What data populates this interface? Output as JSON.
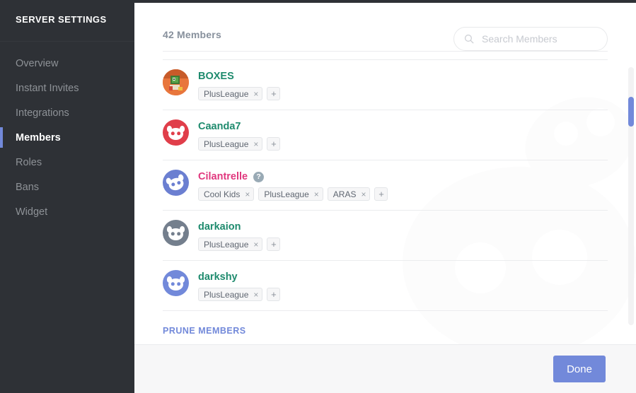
{
  "sidebar": {
    "title": "SERVER SETTINGS",
    "items": [
      {
        "label": "Overview",
        "active": false
      },
      {
        "label": "Instant Invites",
        "active": false
      },
      {
        "label": "Integrations",
        "active": false
      },
      {
        "label": "Members",
        "active": true
      },
      {
        "label": "Roles",
        "active": false
      },
      {
        "label": "Bans",
        "active": false
      },
      {
        "label": "Widget",
        "active": false
      }
    ]
  },
  "main": {
    "member_count_label": "42 Members",
    "search": {
      "placeholder": "Search Members",
      "value": "",
      "icon": "search-icon"
    },
    "prune_label": "PRUNE MEMBERS",
    "role_add_label": "+",
    "role_remove_label": "×",
    "pending_badge_label": "?",
    "members": [
      {
        "name": "BOXES",
        "name_color": "#1f8b6e",
        "avatar_type": "image-yoshi",
        "avatar_bg": "#e8763c",
        "pending": false,
        "roles": [
          "PlusLeague"
        ]
      },
      {
        "name": "Caanda7",
        "name_color": "#1f8b6e",
        "avatar_type": "clyde",
        "avatar_bg": "#e03e4a",
        "pending": false,
        "roles": [
          "PlusLeague"
        ]
      },
      {
        "name": "Cilantrelle",
        "name_color": "#e0387e",
        "avatar_type": "clyde-tilt",
        "avatar_bg": "#6b7fd1",
        "pending": true,
        "roles": [
          "Cool Kids",
          "PlusLeague",
          "ARAS"
        ]
      },
      {
        "name": "darkaion",
        "name_color": "#1f8b6e",
        "avatar_type": "clyde",
        "avatar_bg": "#747f8d",
        "pending": false,
        "roles": [
          "PlusLeague"
        ]
      },
      {
        "name": "darkshy",
        "name_color": "#1f8b6e",
        "avatar_type": "clyde",
        "avatar_bg": "#7289da",
        "pending": false,
        "roles": [
          "PlusLeague"
        ]
      }
    ]
  },
  "footer": {
    "done_label": "Done"
  },
  "colors": {
    "brand_blurple": "#7289da",
    "sidebar_bg": "#2e3136",
    "footer_bg": "#f7f7f8",
    "divider": "#ebecee"
  }
}
